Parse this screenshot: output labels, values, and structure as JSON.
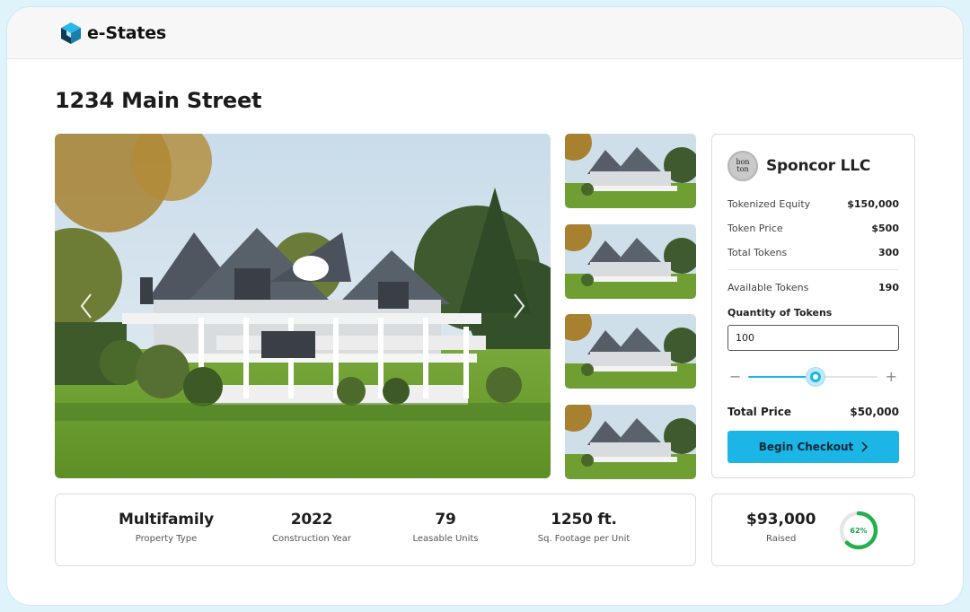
{
  "header": {
    "brand_name": "e-States",
    "logo_icon": "cube-logo-icon"
  },
  "page_title": "1234 Main Street",
  "gallery": {
    "prev_icon": "chevron-left-icon",
    "next_icon": "chevron-right-icon",
    "thumbnail_count": 4
  },
  "sponsor": {
    "avatar_text_line1": "bon",
    "avatar_text_line2": "ton",
    "name": "Sponcor LLC",
    "rows": [
      {
        "label": "Tokenized Equity",
        "value": "$150,000"
      },
      {
        "label": "Token Price",
        "value": "$500"
      },
      {
        "label": "Total Tokens",
        "value": "300"
      },
      {
        "label": "Available Tokens",
        "value": "190"
      }
    ],
    "quantity_label": "Quantity of Tokens",
    "quantity_value": "100",
    "slider": {
      "minus": "−",
      "plus": "+",
      "level_fraction": 0.52
    },
    "total_label": "Total Price",
    "total_value": "$50,000",
    "checkout_label": "Begin Checkout"
  },
  "stats": [
    {
      "value": "Multifamily",
      "label": "Property Type"
    },
    {
      "value": "2022",
      "label": "Construction Year"
    },
    {
      "value": "79",
      "label": "Leasable Units"
    },
    {
      "value": "1250 ft.",
      "label": "Sq. Footage per Unit"
    }
  ],
  "raised": {
    "value": "$93,000",
    "label": "Raised",
    "percent_text": "62%",
    "percent": 62
  },
  "colors": {
    "accent": "#1bb6e6",
    "progress": "#22b14c",
    "logo_dark": "#0d3b52",
    "logo_light": "#29b8e8"
  }
}
